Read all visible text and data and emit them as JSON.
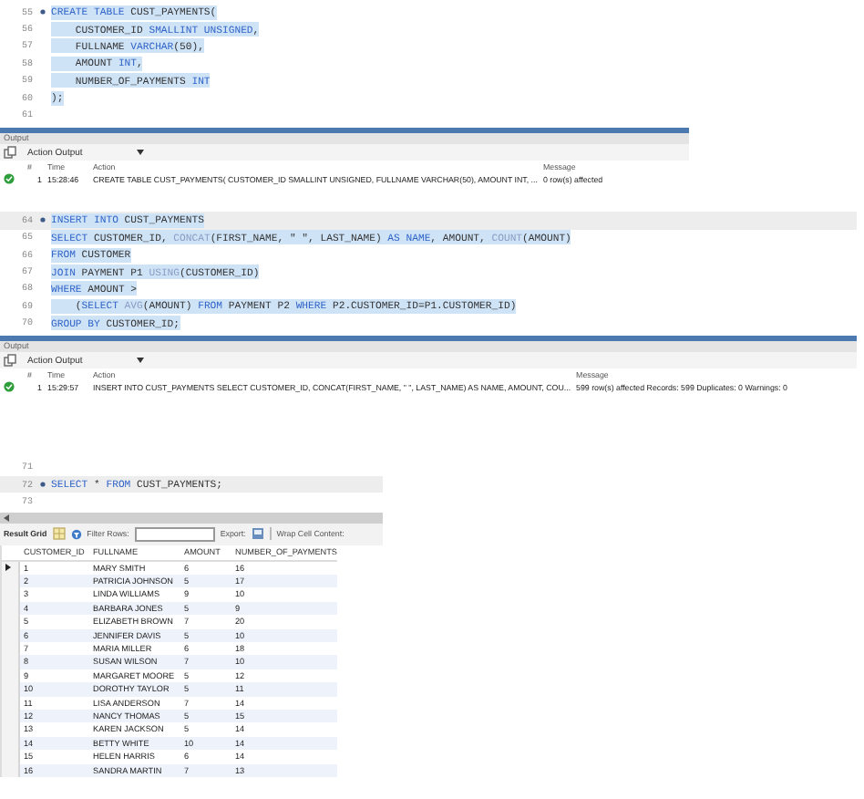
{
  "panels": [
    {
      "editor": {
        "lines": [
          {
            "number": "55",
            "marker": true,
            "selected": true,
            "current": false,
            "tokens": [
              {
                "kind": "keyword",
                "text": "CREATE TABLE"
              },
              {
                "kind": "plain",
                "text": " CUST_PAYMENTS("
              }
            ]
          },
          {
            "number": "56",
            "marker": false,
            "selected": true,
            "current": false,
            "tokens": [
              {
                "kind": "plain",
                "text": "    CUSTOMER_ID "
              },
              {
                "kind": "keyword",
                "text": "SMALLINT UNSIGNED"
              },
              {
                "kind": "plain",
                "text": ","
              }
            ]
          },
          {
            "number": "57",
            "marker": false,
            "selected": true,
            "current": false,
            "tokens": [
              {
                "kind": "plain",
                "text": "    FULLNAME "
              },
              {
                "kind": "keyword",
                "text": "VARCHAR"
              },
              {
                "kind": "plain",
                "text": "(50),"
              }
            ]
          },
          {
            "number": "58",
            "marker": false,
            "selected": true,
            "current": false,
            "tokens": [
              {
                "kind": "plain",
                "text": "    AMOUNT "
              },
              {
                "kind": "keyword",
                "text": "INT"
              },
              {
                "kind": "plain",
                "text": ","
              }
            ]
          },
          {
            "number": "59",
            "marker": false,
            "selected": true,
            "current": false,
            "tokens": [
              {
                "kind": "plain",
                "text": "    NUMBER_OF_PAYMENTS "
              },
              {
                "kind": "keyword",
                "text": "INT"
              }
            ]
          },
          {
            "number": "60",
            "marker": false,
            "selected": true,
            "current": false,
            "tokens": [
              {
                "kind": "plain",
                "text": ");"
              }
            ]
          },
          {
            "number": "61",
            "marker": false,
            "current": false
          }
        ]
      },
      "output": {
        "title": "Output",
        "view": "Action Output",
        "columns": [
          "#",
          "Time",
          "Action",
          "Message"
        ],
        "rows": [
          {
            "success": true,
            "index": "1",
            "time": "15:28:46",
            "action": "CREATE TABLE CUST_PAYMENTS(    CUSTOMER_ID SMALLINT UNSIGNED,    FULLNAME VARCHAR(50),    AMOUNT INT,  ...",
            "message": "0 row(s) affected"
          }
        ]
      }
    },
    {
      "editor": {
        "lines": [
          {
            "number": "64",
            "marker": true,
            "selected": true,
            "current": true,
            "tokens": [
              {
                "kind": "keyword",
                "text": "INSERT INTO"
              },
              {
                "kind": "plain",
                "text": " CUST_PAYMENTS"
              }
            ]
          },
          {
            "number": "65",
            "marker": false,
            "selected": true,
            "current": false,
            "tokens": [
              {
                "kind": "keyword",
                "text": "SELECT"
              },
              {
                "kind": "plain",
                "text": " CUSTOMER_ID, "
              },
              {
                "kind": "function",
                "text": "CONCAT"
              },
              {
                "kind": "plain",
                "text": "(FIRST_NAME, \" \", LAST_NAME) "
              },
              {
                "kind": "keyword",
                "text": "AS NAME"
              },
              {
                "kind": "plain",
                "text": ", AMOUNT, "
              },
              {
                "kind": "function",
                "text": "COUNT"
              },
              {
                "kind": "plain",
                "text": "(AMOUNT)"
              }
            ]
          },
          {
            "number": "66",
            "marker": false,
            "selected": true,
            "current": false,
            "tokens": [
              {
                "kind": "keyword",
                "text": "FROM"
              },
              {
                "kind": "plain",
                "text": " CUSTOMER"
              }
            ]
          },
          {
            "number": "67",
            "marker": false,
            "selected": true,
            "current": false,
            "tokens": [
              {
                "kind": "keyword",
                "text": "JOIN"
              },
              {
                "kind": "plain",
                "text": " PAYMENT P1 "
              },
              {
                "kind": "function",
                "text": "USING"
              },
              {
                "kind": "plain",
                "text": "(CUSTOMER_ID)"
              }
            ]
          },
          {
            "number": "68",
            "marker": false,
            "selected": true,
            "current": false,
            "tokens": [
              {
                "kind": "keyword",
                "text": "WHERE"
              },
              {
                "kind": "plain",
                "text": " AMOUNT >"
              }
            ]
          },
          {
            "number": "69",
            "marker": false,
            "selected": true,
            "current": false,
            "tokens": [
              {
                "kind": "plain",
                "text": "    ("
              },
              {
                "kind": "keyword",
                "text": "SELECT "
              },
              {
                "kind": "function",
                "text": "AVG"
              },
              {
                "kind": "plain",
                "text": "(AMOUNT) "
              },
              {
                "kind": "keyword",
                "text": "FROM"
              },
              {
                "kind": "plain",
                "text": " PAYMENT P2 "
              },
              {
                "kind": "keyword",
                "text": "WHERE"
              },
              {
                "kind": "plain",
                "text": " P2.CUSTOMER_ID=P1.CUSTOMER_ID)"
              }
            ]
          },
          {
            "number": "70",
            "marker": false,
            "selected": true,
            "current": false,
            "tokens": [
              {
                "kind": "keyword",
                "text": "GROUP BY"
              },
              {
                "kind": "plain",
                "text": " CUSTOMER_ID;"
              }
            ]
          }
        ]
      },
      "output": {
        "title": "Output",
        "view": "Action Output",
        "columns": [
          "#",
          "Time",
          "Action",
          "Message"
        ],
        "rows": [
          {
            "success": true,
            "index": "1",
            "time": "15:29:57",
            "action": "INSERT INTO CUST_PAYMENTS  SELECT CUSTOMER_ID, CONCAT(FIRST_NAME, \" \", LAST_NAME) AS NAME, AMOUNT, COU...",
            "message": "599 row(s) affected Records: 599  Duplicates: 0  Warnings: 0"
          }
        ]
      }
    },
    {
      "editor": {
        "lines": [
          {
            "number": "71",
            "marker": false,
            "current": false
          },
          {
            "number": "72",
            "marker": true,
            "selected": false,
            "current": true,
            "tokens": [
              {
                "kind": "keyword",
                "text": "SELECT"
              },
              {
                "kind": "plain",
                "text": " * "
              },
              {
                "kind": "keyword",
                "text": "FROM"
              },
              {
                "kind": "plain",
                "text": " CUST_PAYMENTS;"
              }
            ]
          },
          {
            "number": "73",
            "marker": false,
            "current": false
          }
        ]
      },
      "result_grid": {
        "label": "Result Grid",
        "filter_label": "Filter Rows:",
        "export_label": "Export:",
        "wrap_label": "Wrap Cell Content:",
        "columns": [
          "CUSTOMER_ID",
          "FULLNAME",
          "AMOUNT",
          "NUMBER_OF_PAYMENTS"
        ],
        "rows": [
          {
            "selected": true,
            "cells": [
              "1",
              "MARY SMITH",
              "6",
              "16"
            ]
          },
          {
            "selected": false,
            "cells": [
              "2",
              "PATRICIA JOHNSON",
              "5",
              "17"
            ]
          },
          {
            "selected": false,
            "cells": [
              "3",
              "LINDA WILLIAMS",
              "9",
              "10"
            ]
          },
          {
            "selected": false,
            "cells": [
              "4",
              "BARBARA JONES",
              "5",
              "9"
            ]
          },
          {
            "selected": false,
            "cells": [
              "5",
              "ELIZABETH BROWN",
              "7",
              "20"
            ]
          },
          {
            "selected": false,
            "cells": [
              "6",
              "JENNIFER DAVIS",
              "5",
              "10"
            ]
          },
          {
            "selected": false,
            "cells": [
              "7",
              "MARIA MILLER",
              "6",
              "18"
            ]
          },
          {
            "selected": false,
            "cells": [
              "8",
              "SUSAN WILSON",
              "7",
              "10"
            ]
          },
          {
            "selected": false,
            "cells": [
              "9",
              "MARGARET MOORE",
              "5",
              "12"
            ]
          },
          {
            "selected": false,
            "cells": [
              "10",
              "DOROTHY TAYLOR",
              "5",
              "11"
            ]
          },
          {
            "selected": false,
            "cells": [
              "11",
              "LISA ANDERSON",
              "7",
              "14"
            ]
          },
          {
            "selected": false,
            "cells": [
              "12",
              "NANCY THOMAS",
              "5",
              "15"
            ]
          },
          {
            "selected": false,
            "cells": [
              "13",
              "KAREN JACKSON",
              "5",
              "14"
            ]
          },
          {
            "selected": false,
            "cells": [
              "14",
              "BETTY WHITE",
              "10",
              "14"
            ]
          },
          {
            "selected": false,
            "cells": [
              "15",
              "HELEN HARRIS",
              "6",
              "14"
            ]
          },
          {
            "selected": false,
            "cells": [
              "16",
              "SANDRA MARTIN",
              "7",
              "13"
            ]
          }
        ]
      }
    }
  ]
}
